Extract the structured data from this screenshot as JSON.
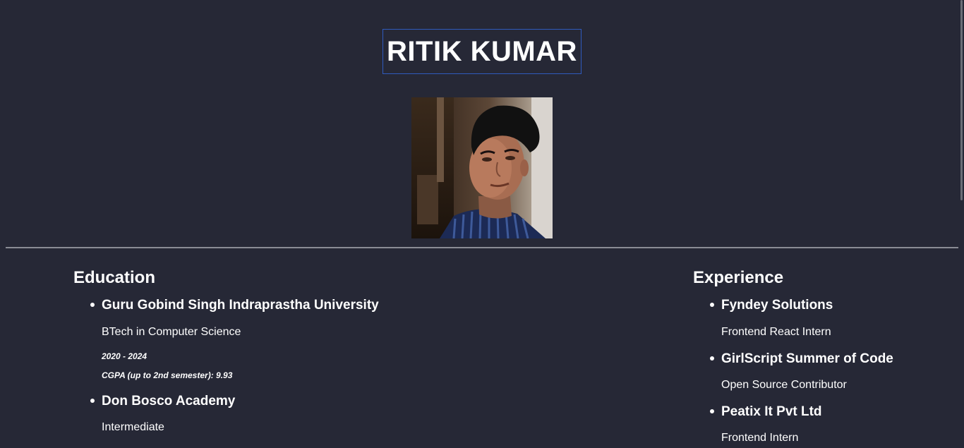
{
  "header": {
    "name": "RITIK KUMAR"
  },
  "profile": {
    "photo_alt": "Profile photo"
  },
  "education": {
    "heading": "Education",
    "items": [
      {
        "institution": "Guru Gobind Singh Indraprastha University",
        "degree": "BTech in Computer Science",
        "years": "2020 - 2024",
        "score": "CGPA (up to 2nd semester): 9.93"
      },
      {
        "institution": "Don Bosco Academy",
        "degree": "Intermediate"
      }
    ]
  },
  "experience": {
    "heading": "Experience",
    "items": [
      {
        "company": "Fyndey Solutions",
        "role": "Frontend React Intern"
      },
      {
        "company": "GirlScript Summer of Code",
        "role": "Open Source Contributor"
      },
      {
        "company": "Peatix It Pvt Ltd",
        "role": "Frontend Intern"
      }
    ]
  },
  "colors": {
    "background": "#262836",
    "name_border": "#2f5bbd",
    "divider": "#8a8c95"
  }
}
